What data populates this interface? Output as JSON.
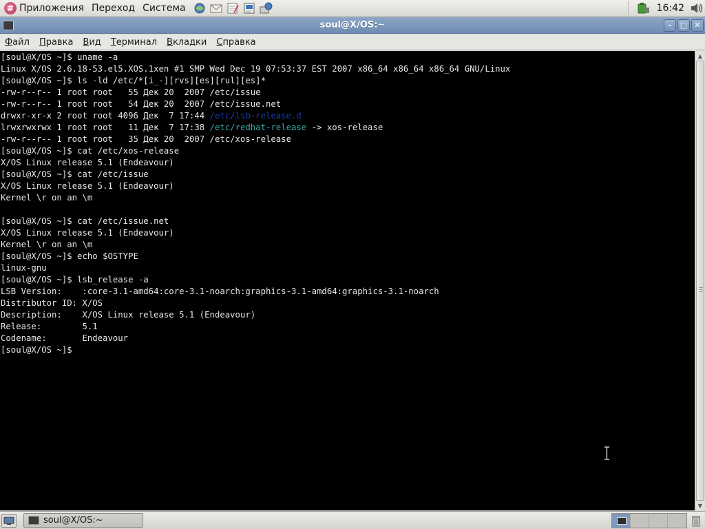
{
  "top_panel": {
    "menus": [
      "Приложения",
      "Переход",
      "Система"
    ],
    "launchers": [
      "web-browser-icon",
      "mail-client-icon",
      "text-editor-icon",
      "office-document-icon",
      "network-places-icon"
    ],
    "tray_icons": [
      "battery-monitor-icon",
      "volume-icon"
    ],
    "clock": "16:42"
  },
  "window": {
    "title": "soul@X/OS:~"
  },
  "terminal_menu": [
    {
      "underline": "Ф",
      "rest": "айл"
    },
    {
      "underline": "П",
      "rest": "равка"
    },
    {
      "underline": "В",
      "rest": "ид"
    },
    {
      "underline": "Т",
      "rest": "ерминал"
    },
    {
      "underline": "В",
      "rest": "кладки"
    },
    {
      "underline": "С",
      "rest": "правка"
    }
  ],
  "terminal": {
    "lines": [
      [
        {
          "text": "[soul@X/OS ~]$ uname -a"
        }
      ],
      [
        {
          "text": "Linux X/OS 2.6.18-53.el5.XOS.1xen #1 SMP Wed Dec 19 07:53:37 EST 2007 x86_64 x86_64 x86_64 GNU/Linux"
        }
      ],
      [
        {
          "text": "[soul@X/OS ~]$ ls -ld /etc/*[i_-][rvs][es][rul][es]*"
        }
      ],
      [
        {
          "text": "-rw-r--r-- 1 root root   55 Дек 20  2007 /etc/issue"
        }
      ],
      [
        {
          "text": "-rw-r--r-- 1 root root   54 Дек 20  2007 /etc/issue.net"
        }
      ],
      [
        {
          "text": "drwxr-xr-x 2 root root 4096 Дек  7 17:44 "
        },
        {
          "text": "/etc/lsb-release.d",
          "color": "blue"
        }
      ],
      [
        {
          "text": "lrwxrwxrwx 1 root root   11 Дек  7 17:38 "
        },
        {
          "text": "/etc/redhat-release",
          "color": "cyan"
        },
        {
          "text": " -> xos-release"
        }
      ],
      [
        {
          "text": "-rw-r--r-- 1 root root   35 Дек 20  2007 /etc/xos-release"
        }
      ],
      [
        {
          "text": "[soul@X/OS ~]$ cat /etc/xos-release"
        }
      ],
      [
        {
          "text": "X/OS Linux release 5.1 (Endeavour)"
        }
      ],
      [
        {
          "text": "[soul@X/OS ~]$ cat /etc/issue"
        }
      ],
      [
        {
          "text": "X/OS Linux release 5.1 (Endeavour)"
        }
      ],
      [
        {
          "text": "Kernel \\r on an \\m"
        }
      ],
      [
        {
          "text": ""
        }
      ],
      [
        {
          "text": "[soul@X/OS ~]$ cat /etc/issue.net"
        }
      ],
      [
        {
          "text": "X/OS Linux release 5.1 (Endeavour)"
        }
      ],
      [
        {
          "text": "Kernel \\r on an \\m"
        }
      ],
      [
        {
          "text": "[soul@X/OS ~]$ echo $OSTYPE"
        }
      ],
      [
        {
          "text": "linux-gnu"
        }
      ],
      [
        {
          "text": "[soul@X/OS ~]$ lsb_release -a"
        }
      ],
      [
        {
          "text": "LSB Version:    :core-3.1-amd64:core-3.1-noarch:graphics-3.1-amd64:graphics-3.1-noarch"
        }
      ],
      [
        {
          "text": "Distributor ID: X/OS"
        }
      ],
      [
        {
          "text": "Description:    X/OS Linux release 5.1 (Endeavour)"
        }
      ],
      [
        {
          "text": "Release:        5.1"
        }
      ],
      [
        {
          "text": "Codename:       Endeavour"
        }
      ],
      [
        {
          "text": "[soul@X/OS ~]$ "
        }
      ]
    ],
    "colors": {
      "blue": "#1c3bb0",
      "cyan": "#3aa6a6",
      "fg": "#e6e6e6",
      "bg": "#000000"
    }
  },
  "taskbar": {
    "window_button": "soul@X/OS:~",
    "workspaces": 4,
    "active_workspace": 1
  },
  "colors": {
    "titlebar": "#7a97bd",
    "panel": "#dedcd8"
  }
}
